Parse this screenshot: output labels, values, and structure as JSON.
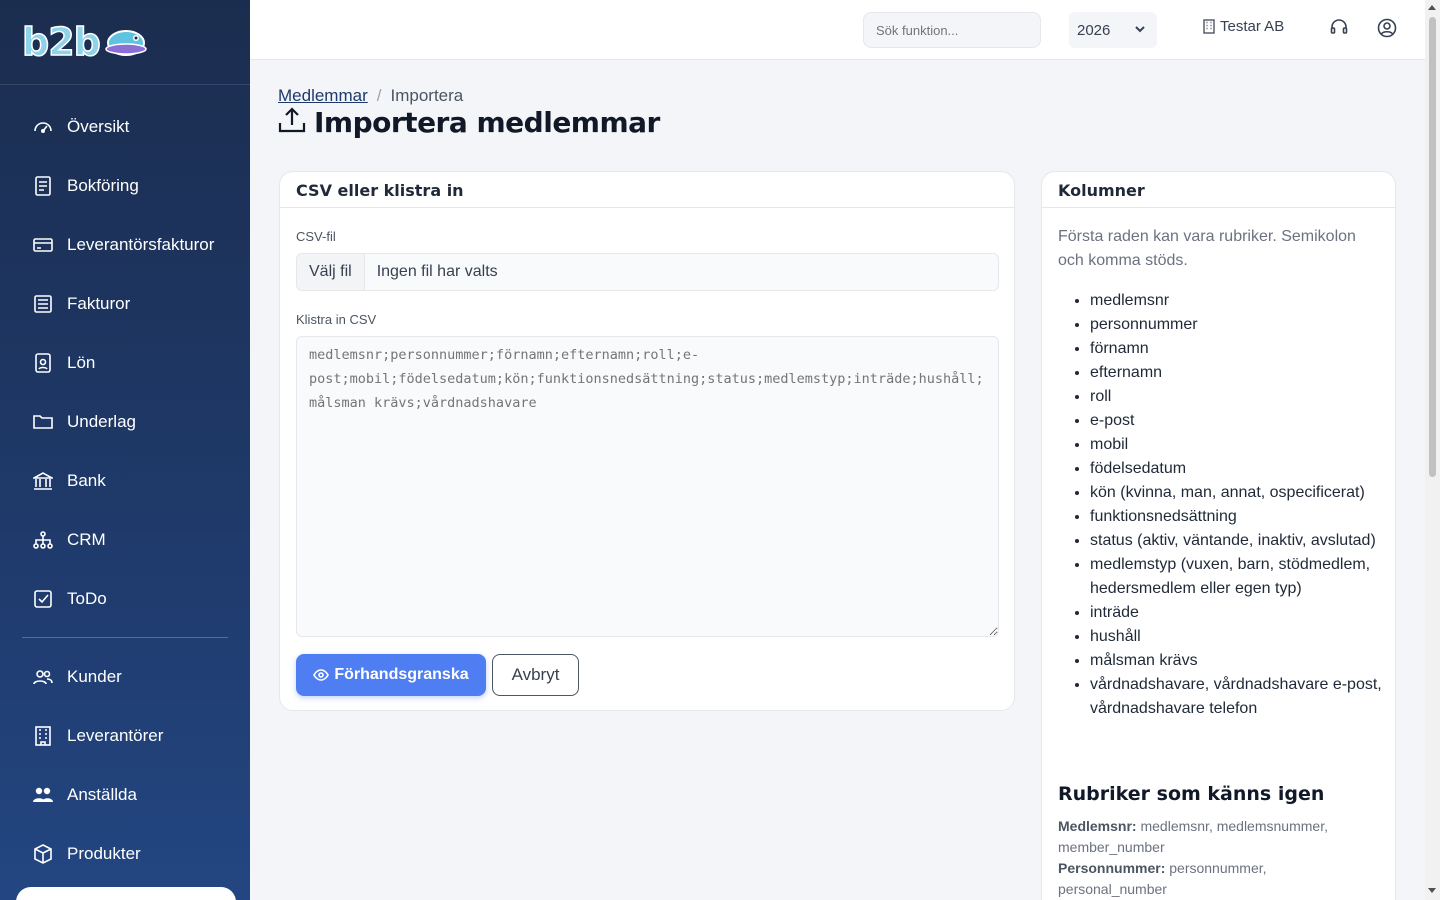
{
  "app": {
    "logo_text": "b2b"
  },
  "sidebar": {
    "items": [
      {
        "label": "Översikt",
        "icon": "gauge-icon"
      },
      {
        "label": "Bokföring",
        "icon": "ledger-icon"
      },
      {
        "label": "Leverantörsfakturor",
        "icon": "credit-card-icon"
      },
      {
        "label": "Fakturor",
        "icon": "invoice-icon"
      },
      {
        "label": "Lön",
        "icon": "badge-icon"
      },
      {
        "label": "Underlag",
        "icon": "folder-icon"
      },
      {
        "label": "Bank",
        "icon": "bank-icon"
      },
      {
        "label": "CRM",
        "icon": "sitemap-icon"
      },
      {
        "label": "ToDo",
        "icon": "checkbox-icon"
      }
    ],
    "items2": [
      {
        "label": "Kunder",
        "icon": "users-icon"
      },
      {
        "label": "Leverantörer",
        "icon": "building-icon"
      },
      {
        "label": "Anställda",
        "icon": "people-icon"
      },
      {
        "label": "Produkter",
        "icon": "box-icon"
      }
    ]
  },
  "topbar": {
    "search_placeholder": "Sök funktion...",
    "year": "2026",
    "company": "Testar AB"
  },
  "breadcrumb": {
    "parent": "Medlemmar",
    "separator": "/",
    "current": "Importera"
  },
  "page": {
    "title": "Importera medlemmar"
  },
  "import_card": {
    "title": "CSV eller klistra in",
    "file_label": "CSV-fil",
    "file_button": "Välj fil",
    "file_status": "Ingen fil har valts",
    "paste_label": "Klistra in CSV",
    "paste_placeholder": "medlemsnr;personnummer;förnamn;efternamn;roll;e-post;mobil;födelsedatum;kön;funktionsnedsättning;status;medlemstyp;inträde;hushåll;målsman krävs;vårdnadshavare",
    "preview_button": "Förhandsgranska",
    "cancel_button": "Avbryt"
  },
  "columns_card": {
    "title": "Kolumner",
    "intro": "Första raden kan vara rubriker. Semikolon och komma stöds.",
    "columns": [
      "medlemsnr",
      "personnummer",
      "förnamn",
      "efternamn",
      "roll",
      "e-post",
      "mobil",
      "födelsedatum",
      "kön (kvinna, man, annat, ospecificerat)",
      "funktionsnedsättning",
      "status (aktiv, väntande, inaktiv, avslutad)",
      "medlemstyp (vuxen, barn, stödmedlem, hedersmedlem eller egen typ)",
      "inträde",
      "hushåll",
      "målsman krävs",
      "vårdnadshavare, vårdnadshavare e-post, vårdnadshavare telefon"
    ],
    "recognized_title": "Rubriker som känns igen",
    "recognized": [
      {
        "key": "Medlemsnr:",
        "values": "medlemsnr, medlemsnummer, member_number"
      },
      {
        "key": "Personnummer:",
        "values": "personnummer, personal_number"
      }
    ]
  },
  "colors": {
    "sidebar": "#1f3a6b",
    "primary": "#4f7df2",
    "background": "#f3f5f8"
  }
}
